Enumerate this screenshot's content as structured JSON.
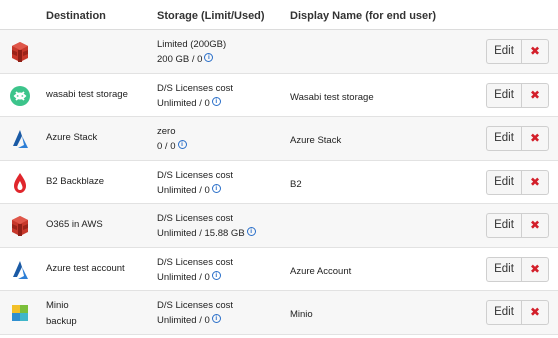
{
  "headers": {
    "destination": "Destination",
    "storage": "Storage (Limit/Used)",
    "display_name": "Display Name (for end user)"
  },
  "info_glyph": "i",
  "colors": {
    "delete": "#d31f2a",
    "info": "#2a6fc9",
    "aws": "#c7382b",
    "wasabi": "#3cc48b",
    "azure": "#1a5aa5",
    "backblaze": "#e0262c"
  },
  "rows": [
    {
      "icon": "aws-s3-icon",
      "destination": "",
      "destination_line2": "",
      "storage_line1": "Limited (200GB)",
      "storage_line2": "200 GB / 0",
      "display_name": "",
      "edit_label": "Edit",
      "delete_label": "✖"
    },
    {
      "icon": "wasabi-icon",
      "destination": "wasabi test storage",
      "destination_line2": "",
      "storage_line1": "D/S Licenses cost",
      "storage_line2": "Unlimited / 0",
      "display_name": "Wasabi test storage",
      "edit_label": "Edit",
      "delete_label": "✖"
    },
    {
      "icon": "azure-icon",
      "destination": "Azure Stack",
      "destination_line2": "",
      "storage_line1": "zero",
      "storage_line2": "0 / 0",
      "display_name": "Azure Stack",
      "edit_label": "Edit",
      "delete_label": "✖"
    },
    {
      "icon": "backblaze-icon",
      "destination": "B2 Backblaze",
      "destination_line2": "",
      "storage_line1": "D/S Licenses cost",
      "storage_line2": "Unlimited / 0",
      "display_name": "B2",
      "edit_label": "Edit",
      "delete_label": "✖"
    },
    {
      "icon": "aws-s3-icon",
      "destination": "O365 in AWS",
      "destination_line2": "",
      "storage_line1": "D/S Licenses cost",
      "storage_line2": "Unlimited / 15.88 GB",
      "display_name": "",
      "edit_label": "Edit",
      "delete_label": "✖"
    },
    {
      "icon": "azure-icon",
      "destination": "Azure test account",
      "destination_line2": "",
      "storage_line1": "D/S Licenses cost",
      "storage_line2": "Unlimited / 0",
      "display_name": "Azure Account",
      "edit_label": "Edit",
      "delete_label": "✖"
    },
    {
      "icon": "minio-icon",
      "destination": "Minio",
      "destination_line2": "backup",
      "storage_line1": "D/S Licenses cost",
      "storage_line2": "Unlimited / 0",
      "display_name": "Minio",
      "edit_label": "Edit",
      "delete_label": "✖"
    }
  ]
}
